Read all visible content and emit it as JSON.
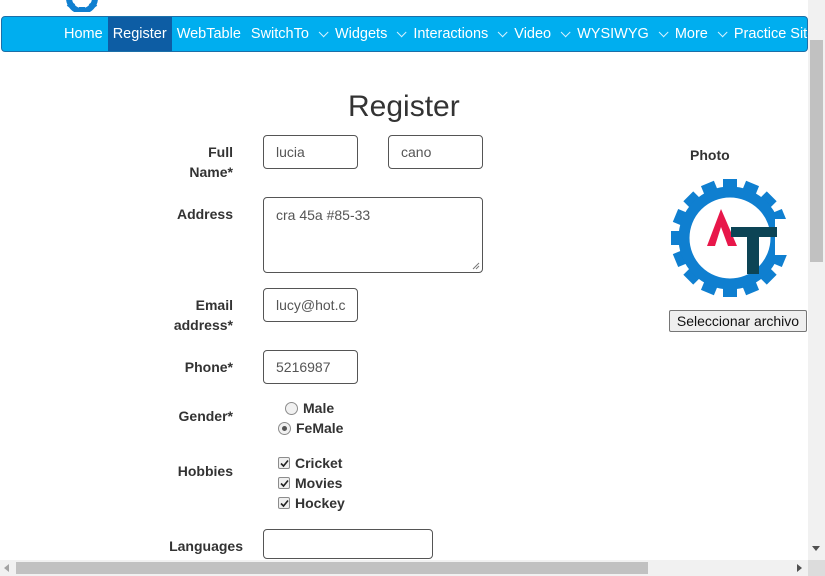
{
  "nav": {
    "items": [
      {
        "label": "Home",
        "active": false,
        "dropdown": false
      },
      {
        "label": "Register",
        "active": true,
        "dropdown": false
      },
      {
        "label": "WebTable",
        "active": false,
        "dropdown": false
      },
      {
        "label": "SwitchTo",
        "active": false,
        "dropdown": true
      },
      {
        "label": "Widgets",
        "active": false,
        "dropdown": true
      },
      {
        "label": "Interactions",
        "active": false,
        "dropdown": true
      },
      {
        "label": "Video",
        "active": false,
        "dropdown": true
      },
      {
        "label": "WYSIWYG",
        "active": false,
        "dropdown": true
      },
      {
        "label": "More",
        "active": false,
        "dropdown": true
      },
      {
        "label": "Practice Site",
        "active": false,
        "dropdown": false
      }
    ]
  },
  "page": {
    "title": "Register"
  },
  "form": {
    "full_name_label": "Full Name*",
    "first_name": "lucia",
    "last_name": "cano",
    "address_label": "Address",
    "address": "cra 45a #85-33",
    "email_label": "Email address*",
    "email": "lucy@hot.c",
    "phone_label": "Phone*",
    "phone": "5216987",
    "gender_label": "Gender*",
    "gender_options": [
      "Male",
      "FeMale"
    ],
    "gender_selected": "FeMale",
    "hobbies_label": "Hobbies",
    "hobbies": [
      {
        "label": "Cricket",
        "checked": true
      },
      {
        "label": "Movies",
        "checked": true
      },
      {
        "label": "Hockey",
        "checked": true
      }
    ],
    "languages_label": "Languages",
    "languages_value": ""
  },
  "photo": {
    "label": "Photo",
    "file_button": "Seleccionar archivo"
  },
  "colors": {
    "navbar": "#00aeef",
    "nav_active": "#0d5da4",
    "logo_blue": "#0f7fd0",
    "logo_red": "#e8174a",
    "logo_dark": "#0c4455"
  },
  "icons": {
    "logo": "automation-testing-gear-logo",
    "check": "checkmark-icon"
  }
}
